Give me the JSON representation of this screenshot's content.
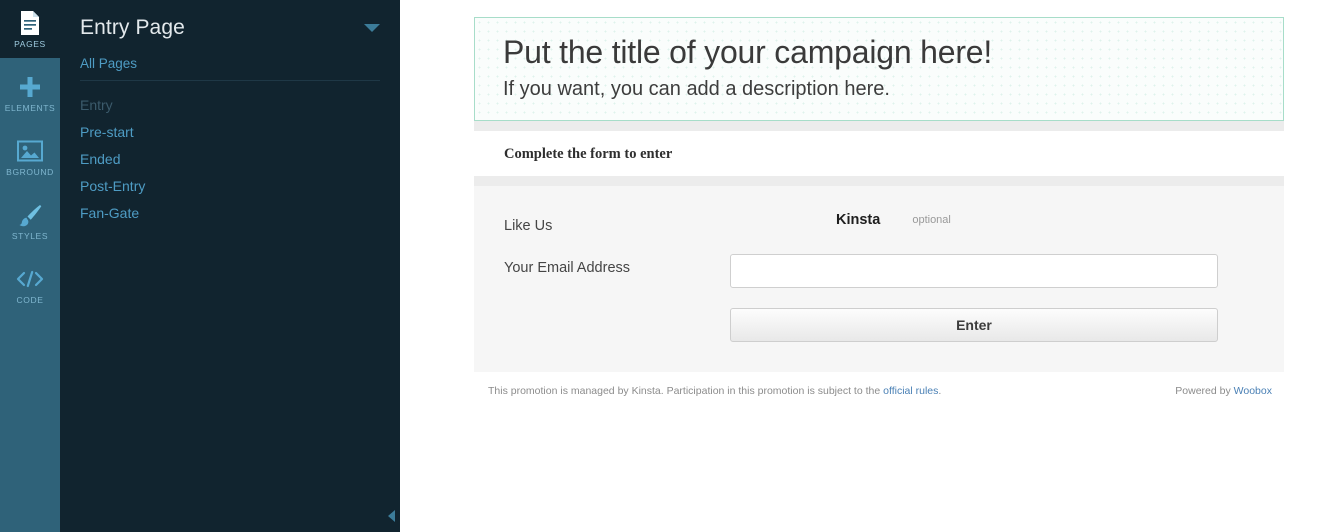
{
  "rail": {
    "items": [
      {
        "label": "PAGES",
        "icon": "document-icon",
        "active": true
      },
      {
        "label": "ELEMENTS",
        "icon": "plus-icon",
        "active": false
      },
      {
        "label": "BGROUND",
        "icon": "image-icon",
        "active": false
      },
      {
        "label": "STYLES",
        "icon": "paintbrush-icon",
        "active": false
      },
      {
        "label": "CODE",
        "icon": "code-icon",
        "active": false
      }
    ]
  },
  "panel": {
    "title": "Entry Page",
    "caret_icon": "chevron-down-icon",
    "all_pages_label": "All Pages",
    "collapse_icon": "chevron-left-icon",
    "pages": [
      {
        "label": "Entry",
        "current": true
      },
      {
        "label": "Pre-start",
        "current": false
      },
      {
        "label": "Ended",
        "current": false
      },
      {
        "label": "Post-Entry",
        "current": false
      },
      {
        "label": "Fan-Gate",
        "current": false
      }
    ]
  },
  "promo": {
    "title": "Put the title of your campaign here!",
    "description": "If you want, you can add a description here.",
    "form_heading": "Complete the form to enter",
    "fields": {
      "like_label": "Like Us",
      "like_brand": "Kinsta",
      "like_optional": "optional",
      "email_label": "Your Email Address",
      "email_value": "",
      "email_placeholder": ""
    },
    "enter_button": "Enter",
    "footer": {
      "legal_prefix": "This promotion is managed by Kinsta. Participation in this promotion is subject to the ",
      "legal_link": "official rules",
      "legal_suffix": ".",
      "powered_prefix": "Powered by ",
      "powered_link": "Woobox"
    }
  },
  "colors": {
    "rail_bg": "#2f6279",
    "panel_bg": "#11242f",
    "panel_link": "#4e9cc4",
    "title_box_border": "#a7ddc9",
    "form_bg": "#f6f6f6",
    "band": "#ececec",
    "footer_link": "#4a80b5"
  }
}
